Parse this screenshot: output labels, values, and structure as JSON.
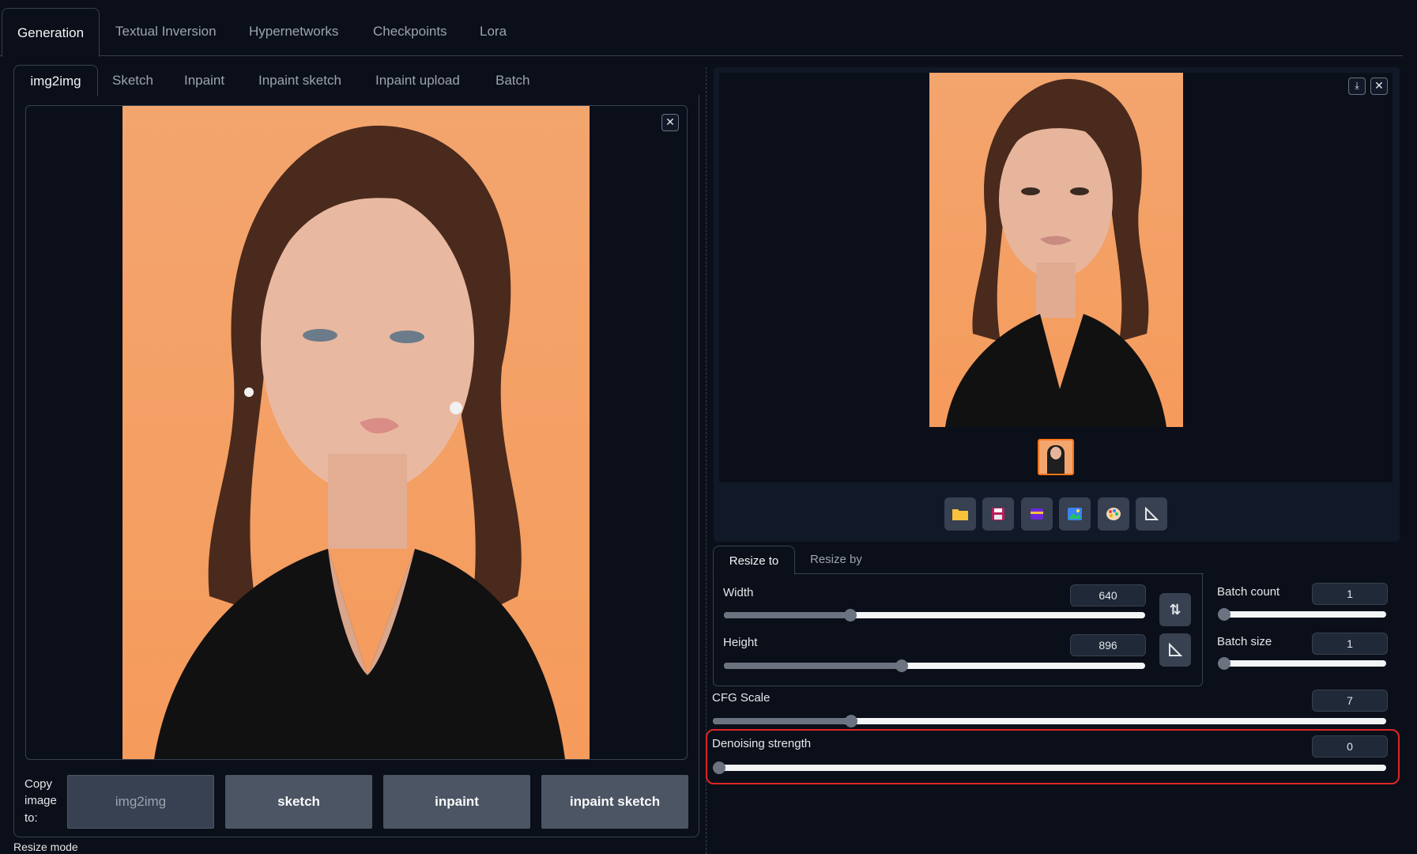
{
  "top_tabs": [
    "Generation",
    "Textual Inversion",
    "Hypernetworks",
    "Checkpoints",
    "Lora"
  ],
  "sub_tabs": [
    "img2img",
    "Sketch",
    "Inpaint",
    "Inpaint sketch",
    "Inpaint upload",
    "Batch"
  ],
  "copy_image": {
    "label_lines": [
      "Copy",
      "image",
      "to:"
    ],
    "buttons": [
      "img2img",
      "sketch",
      "inpaint",
      "inpaint sketch"
    ]
  },
  "resize_mode_label": "Resize mode",
  "resize_tabs": [
    "Resize to",
    "Resize by"
  ],
  "params": {
    "width": {
      "label": "Width",
      "value": "640",
      "fraction": 0.294
    },
    "height": {
      "label": "Height",
      "value": "896",
      "fraction": 0.419
    },
    "batch_count": {
      "label": "Batch count",
      "value": "1",
      "fraction": 0.0
    },
    "batch_size": {
      "label": "Batch size",
      "value": "1",
      "fraction": 0.0
    },
    "cfg_scale": {
      "label": "CFG Scale",
      "value": "7",
      "fraction": 0.2
    },
    "denoising": {
      "label": "Denoising strength",
      "value": "0",
      "fraction": 0.0
    }
  },
  "toolbar_icons": [
    "folder-icon",
    "save-icon",
    "zip-icon",
    "image-icon",
    "palette-icon",
    "ruler-icon"
  ],
  "colors": {
    "background": "#0b0f19",
    "accent_orange": "#f97316",
    "highlight_red": "#dc2626"
  }
}
